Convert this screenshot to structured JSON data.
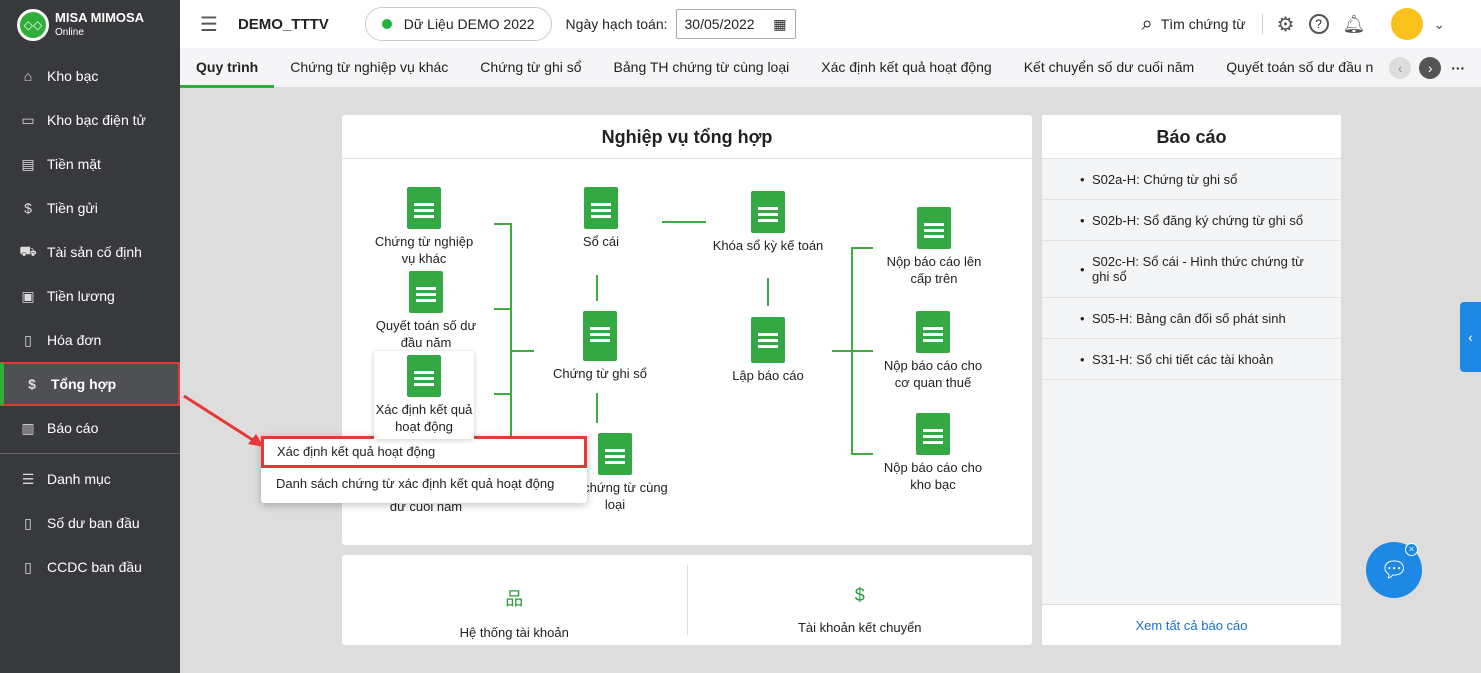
{
  "brand": {
    "name": "MISA MIMOSA",
    "sub": "Online"
  },
  "sidebar": {
    "items": [
      {
        "label": "Kho bạc",
        "icon": "bank-icon"
      },
      {
        "label": "Kho bạc điện tử",
        "icon": "ebank-icon"
      },
      {
        "label": "Tiền mặt",
        "icon": "cash-icon"
      },
      {
        "label": "Tiền gửi",
        "icon": "deposit-icon"
      },
      {
        "label": "Tài sản cố định",
        "icon": "asset-icon"
      },
      {
        "label": "Tiền lương",
        "icon": "salary-icon"
      },
      {
        "label": "Hóa đơn",
        "icon": "invoice-icon"
      },
      {
        "label": "Tổng hợp",
        "icon": "summary-icon"
      },
      {
        "label": "Báo cáo",
        "icon": "report-icon"
      }
    ],
    "items2": [
      {
        "label": "Danh mục"
      },
      {
        "label": "Số dư ban đầu"
      },
      {
        "label": "CCDC ban đầu"
      }
    ]
  },
  "header": {
    "company": "DEMO_TTTV",
    "dataset": "Dữ Liệu DEMO 2022",
    "date_label": "Ngày hạch toán:",
    "date": "30/05/2022",
    "search": "Tìm chứng từ"
  },
  "tabs": [
    "Quy trình",
    "Chứng từ nghiệp vụ khác",
    "Chứng từ ghi sổ",
    "Bảng TH chứng từ cùng loại",
    "Xác định kết quả hoạt động",
    "Kết chuyển số dư cuối năm",
    "Quyết toán số dư đầu n"
  ],
  "flow": {
    "title": "Nghiệp vụ tổng hợp",
    "nodes": {
      "ctnvk": "Chứng từ nghiệp vụ khác",
      "qtsd": "Quyết toán số dư đầu năm",
      "xdkq": "Xác định kết quả hoạt động",
      "kcsd": "dư cuối năm",
      "socai": "Sổ cái",
      "ctgs": "Chứng từ ghi sổ",
      "bth": "TH chứng từ cùng loại",
      "khoaso": "Khóa sổ kỳ kế toán",
      "lapbc": "Lập báo cáo",
      "nop1": "Nộp báo cáo lên cấp trên",
      "nop2": "Nộp báo cáo cho cơ quan thuế",
      "nop3": "Nộp báo cáo cho kho bạc"
    }
  },
  "menu": [
    "Xác định kết quả hoạt động",
    "Danh sách chứng từ xác định kết quả hoạt động"
  ],
  "bottom": {
    "a": "Hệ thống tài khoản",
    "b": "Tài khoản kết chuyển"
  },
  "reports": {
    "title": "Báo cáo",
    "items": [
      "S02a-H: Chứng từ ghi sổ",
      "S02b-H: Sổ đăng ký chứng từ ghi sổ",
      "S02c-H: Sổ cái - Hình thức chứng từ ghi sổ",
      "S05-H: Bảng cân đối số phát sinh",
      "S31-H: Sổ chi tiết các tài khoản"
    ],
    "view_all": "Xem tất cả báo cáo"
  }
}
